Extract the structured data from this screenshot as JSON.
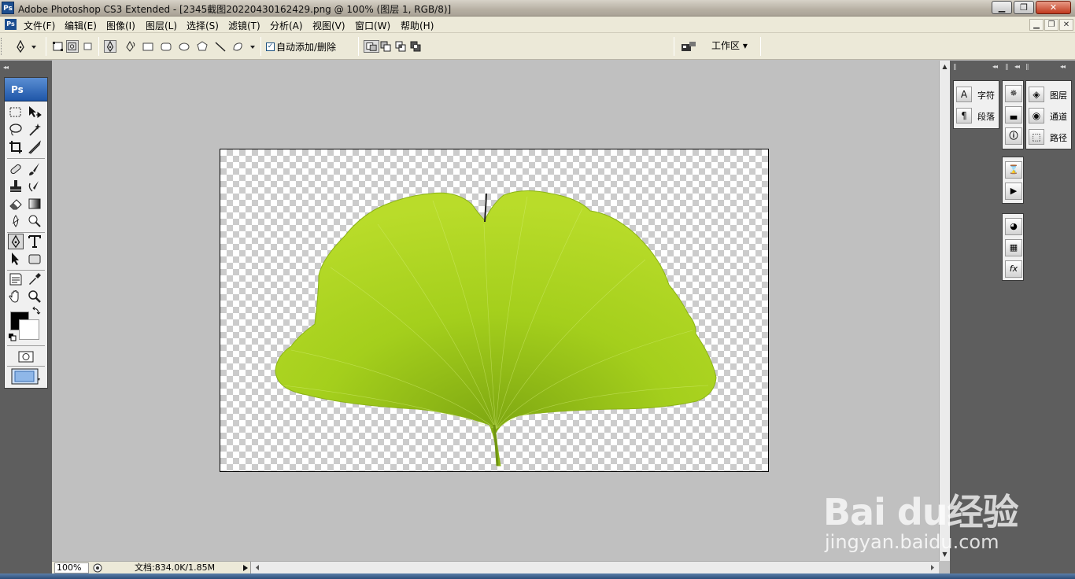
{
  "window": {
    "title": "Adobe Photoshop CS3 Extended - [2345截图20220430162429.png @ 100% (图层 1, RGB/8)]",
    "logo": "Ps",
    "controls": [
      "minimize",
      "maximize",
      "close"
    ]
  },
  "menubar": {
    "logo": "Ps",
    "items": [
      "文件(F)",
      "编辑(E)",
      "图像(I)",
      "图层(L)",
      "选择(S)",
      "滤镜(T)",
      "分析(A)",
      "视图(V)",
      "窗口(W)",
      "帮助(H)"
    ]
  },
  "options": {
    "auto_add_delete_label": "自动添加/删除",
    "auto_add_delete_checked": true,
    "workspace_label": "工作区 ▾"
  },
  "toolbox": {
    "logo": "Ps"
  },
  "status": {
    "zoom": "100%",
    "doc_info": "文档:834.0K/1.85M"
  },
  "dock": {
    "group1": [
      {
        "icon": "A",
        "label": "字符"
      },
      {
        "icon": "¶",
        "label": "段落"
      }
    ],
    "group3": [
      {
        "label": "图层"
      },
      {
        "label": "通道"
      },
      {
        "label": "路径"
      }
    ]
  },
  "watermark": {
    "brand": "Bai du经验",
    "url": "jingyan.baidu.com"
  },
  "colors": {
    "foreground": "#000000",
    "background": "#ffffff",
    "leaf": "#a8d41a"
  }
}
